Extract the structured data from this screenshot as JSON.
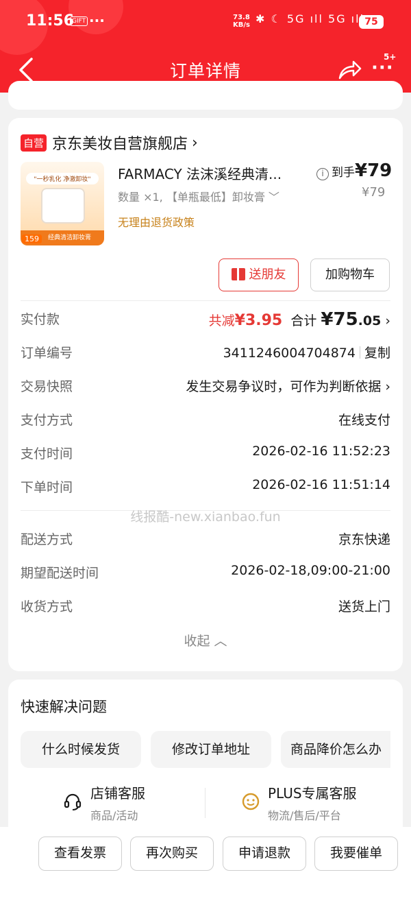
{
  "status_bar": {
    "time": "11:56",
    "notification_badge": "GIFT",
    "more_dots": "···",
    "net_speed": "73.8",
    "net_unit": "KB/s",
    "icons": "✱ ☾ 5G ıll 5G ıll ≋",
    "battery": "75"
  },
  "nav": {
    "title": "订单详情",
    "more": "···",
    "badge": "5+"
  },
  "colors": {
    "brand_red": "#f5232b",
    "price_red": "#e53935",
    "policy_gold": "#c7821b"
  },
  "store": {
    "self_tag": "自营",
    "name": "京东美妆自营旗舰店",
    "chevron": "›"
  },
  "product": {
    "image_slogan": "\"一秒乳化 净澈卸妆\"",
    "image_price": "159",
    "image_caption": "经典清洁卸妆膏100ml",
    "title": "FARMACY 法沫溪经典清...",
    "spec": "数量 ×1, 【单瓶最低】卸妆膏  ﹀",
    "policy": "无理由退货政策",
    "price_label": "到手",
    "price_value": "¥79",
    "original_price": "¥79",
    "gift_button": "送朋友",
    "cart_button": "加购物车"
  },
  "order": {
    "paid_label": "实付款",
    "reduce_prefix": "共减",
    "reduce_value": "¥3.95",
    "total_prefix": "合计",
    "total_int": "¥75",
    "total_dec": ".05",
    "chevron": "›",
    "order_no_label": "订单编号",
    "order_no": "3411246004704874",
    "copy": "复制",
    "snapshot_label": "交易快照",
    "snapshot_value": "发生交易争议时，可作为判断依据",
    "pay_method_label": "支付方式",
    "pay_method": "在线支付",
    "pay_time_label": "支付时间",
    "pay_time": "2026-02-16 11:52:23",
    "order_time_label": "下单时间",
    "order_time": "2026-02-16 11:51:14",
    "watermark": "线报酷-new.xianbao.fun",
    "delivery_label": "配送方式",
    "delivery": "京东快递",
    "expected_label": "期望配送时间",
    "expected": "2026-02-18,09:00-21:00",
    "receive_label": "收货方式",
    "receive": "送货上门",
    "collapse": "收起 ︿"
  },
  "help": {
    "title": "快速解决问题",
    "chips": [
      "什么时候发货",
      "修改订单地址",
      "商品降价怎么办"
    ],
    "store_service_title": "店铺客服",
    "store_service_sub": "商品/活动",
    "plus_service_title": "PLUS专属客服",
    "plus_service_sub": "物流/售后/平台"
  },
  "bottom_buttons": [
    "查看发票",
    "再次购买",
    "申请退款",
    "我要催单"
  ]
}
